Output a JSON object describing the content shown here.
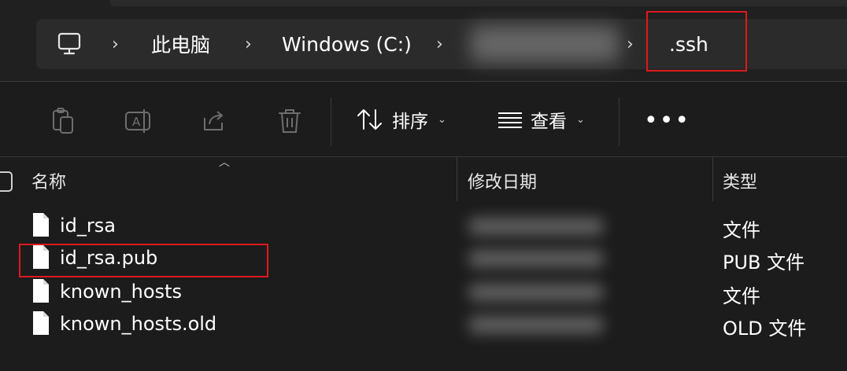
{
  "breadcrumb": {
    "root_icon": "monitor-icon",
    "items": [
      "此电脑",
      "Windows (C:)",
      "",
      ".ssh"
    ]
  },
  "toolbar": {
    "icons": [
      "clipboard-icon",
      "rename-icon",
      "share-icon",
      "delete-icon"
    ],
    "sort_label": "排序",
    "view_label": "查看",
    "more_label": "•••"
  },
  "columns": {
    "name": "名称",
    "modified": "修改日期",
    "type": "类型"
  },
  "files": [
    {
      "name": "id_rsa",
      "type": "文件"
    },
    {
      "name": "id_rsa.pub",
      "type": "PUB 文件"
    },
    {
      "name": "known_hosts",
      "type": "文件"
    },
    {
      "name": "known_hosts.old",
      "type": "OLD 文件"
    }
  ],
  "colors": {
    "highlight": "#e0191b",
    "background": "#1c1c1c",
    "address_bar": "#2b2b2b"
  }
}
